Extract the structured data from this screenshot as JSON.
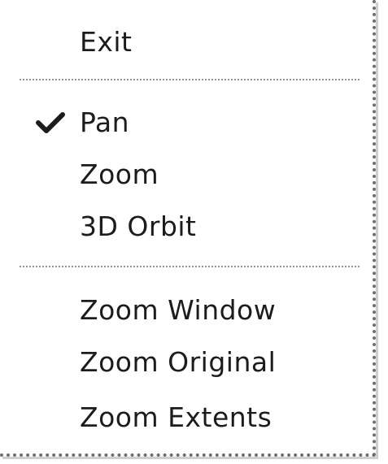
{
  "menu": {
    "items": [
      {
        "label": "Exit"
      },
      {
        "label": "Pan",
        "checked": true
      },
      {
        "label": "Zoom"
      },
      {
        "label": "3D Orbit"
      },
      {
        "label": "Zoom Window"
      },
      {
        "label": "Zoom Original"
      },
      {
        "label": "Zoom Extents"
      }
    ],
    "check_icon": "checkmark-icon"
  },
  "colors": {
    "background": "#ffffff",
    "text": "#1c1c1c",
    "separator": "#a08f96",
    "border": "#6e6e6e"
  }
}
